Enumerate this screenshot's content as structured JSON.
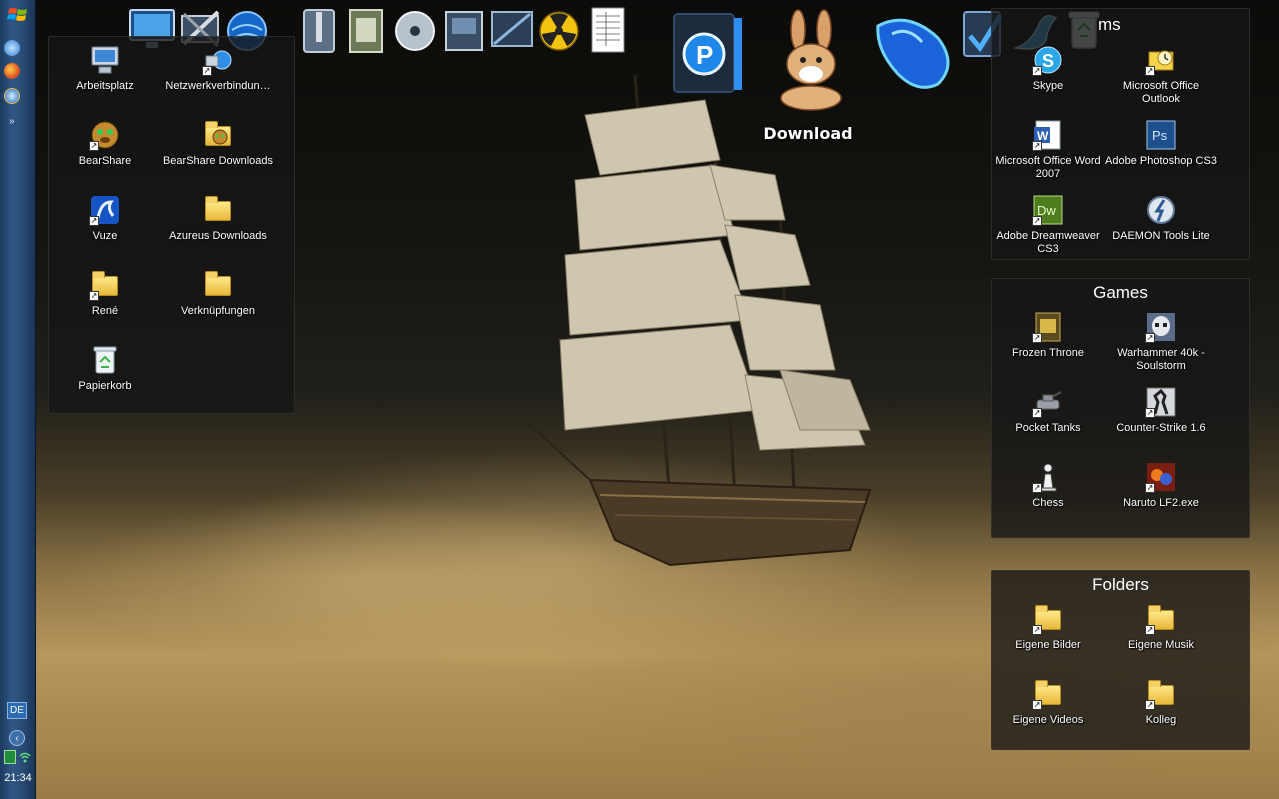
{
  "taskbar": {
    "start_icon": "windows-flag-icon",
    "quick_launch": [
      "ie-icon",
      "firefox-icon",
      "ie-blue-icon"
    ],
    "expand_glyph": "»",
    "language": "DE",
    "clock": "21:34"
  },
  "dock": {
    "icons": [
      "monitor-icon",
      "network-tools-icon",
      "globe-icon",
      "zip-icon",
      "document-icon",
      "dvd-icon",
      "video-icon",
      "screen-icon",
      "radioactive-icon",
      "spreadsheet-icon",
      "p-docs-icon",
      "emule-icon",
      "mouse-icon",
      "checkmark-icon",
      "skype-icon",
      "recycle-bin-icon"
    ],
    "active_label": "Download"
  },
  "left_fence": {
    "items": [
      {
        "label": "Arbeitsplatz",
        "icon": "computer-icon"
      },
      {
        "label": "Netzwerkverbindun…",
        "icon": "network-icon"
      },
      {
        "label": "BearShare",
        "icon": "bearshare-icon"
      },
      {
        "label": "BearShare Downloads",
        "icon": "bearshare-folder-icon"
      },
      {
        "label": "Vuze",
        "icon": "vuze-icon"
      },
      {
        "label": "Azureus Downloads",
        "icon": "folder-icon"
      },
      {
        "label": "René",
        "icon": "folder-icon"
      },
      {
        "label": "Verknüpfungen",
        "icon": "folder-icon"
      },
      {
        "label": "Papierkorb",
        "icon": "recycle-bin-icon"
      }
    ]
  },
  "programs_fence": {
    "title": "ms",
    "items": [
      {
        "label": "Skype",
        "icon": "skype-icon"
      },
      {
        "label": "Microsoft Office Outlook",
        "icon": "outlook-icon"
      },
      {
        "label": "Microsoft Office Word 2007",
        "icon": "word-icon"
      },
      {
        "label": "Adobe Photoshop CS3",
        "icon": "photoshop-icon"
      },
      {
        "label": "Adobe Dreamweaver CS3",
        "icon": "dreamweaver-icon"
      },
      {
        "label": "DAEMON Tools Lite",
        "icon": "daemon-tools-icon"
      }
    ]
  },
  "games_fence": {
    "title": "Games",
    "items": [
      {
        "label": "Frozen Throne",
        "icon": "frozen-throne-icon"
      },
      {
        "label": "Warhammer 40k - Soulstorm",
        "icon": "warhammer-icon"
      },
      {
        "label": "Pocket Tanks",
        "icon": "tank-icon"
      },
      {
        "label": "Counter-Strike 1.6",
        "icon": "counter-strike-icon"
      },
      {
        "label": "Chess",
        "icon": "chess-icon"
      },
      {
        "label": "Naruto LF2.exe",
        "icon": "naruto-icon"
      }
    ]
  },
  "folders_fence": {
    "title": "Folders",
    "items": [
      {
        "label": "Eigene Bilder",
        "icon": "folder-icon"
      },
      {
        "label": "Eigene Musik",
        "icon": "folder-icon"
      },
      {
        "label": "Eigene Videos",
        "icon": "folder-icon"
      },
      {
        "label": "Kolleg",
        "icon": "folder-icon"
      }
    ]
  },
  "colors": {
    "taskbar_blue": "#2f5784",
    "fence_bg": "#161616",
    "sand": "#b8975d"
  }
}
